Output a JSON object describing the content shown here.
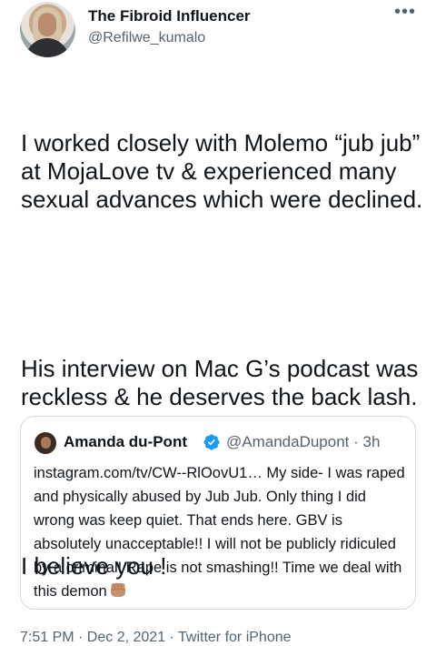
{
  "author": {
    "display_name": "The Fibroid Influencer",
    "handle": "@Refilwe_kumalo"
  },
  "more_icon": "more-horizontal-icon",
  "tweet": {
    "paragraphs": [
      "I worked closely with Molemo “jub jub” at MojaLove tv & experienced many sexual advances which were declined.",
      "His interview on Mac G’s podcast was reckless & he deserves the back lash.",
      "I believe you !"
    ]
  },
  "quoted_tweet": {
    "display_name": "Amanda du-Pont",
    "verified_icon": "verified-badge-icon",
    "handle_time": "@AmandaDupont · 3h",
    "text": "instagram.com/tv/CW--RlOovU1… My side- I was raped and physically abused by Jub Jub. Only thing I did wrong was keep quiet. That ends here. GBV is absolutely unacceptable!! I will not be publicly ridiculed by a criminal! Rape is not smashing!! Time we deal with this demon",
    "emoji": "raised-fist-medium-skin-tone-icon"
  },
  "meta": "7:51 PM · Dec 2, 2021 · Twitter for iPhone",
  "colors": {
    "primary_text": "#0f1419",
    "secondary_text": "#536471",
    "border": "#cfd9de",
    "verified_blue": "#1d9bf0"
  }
}
